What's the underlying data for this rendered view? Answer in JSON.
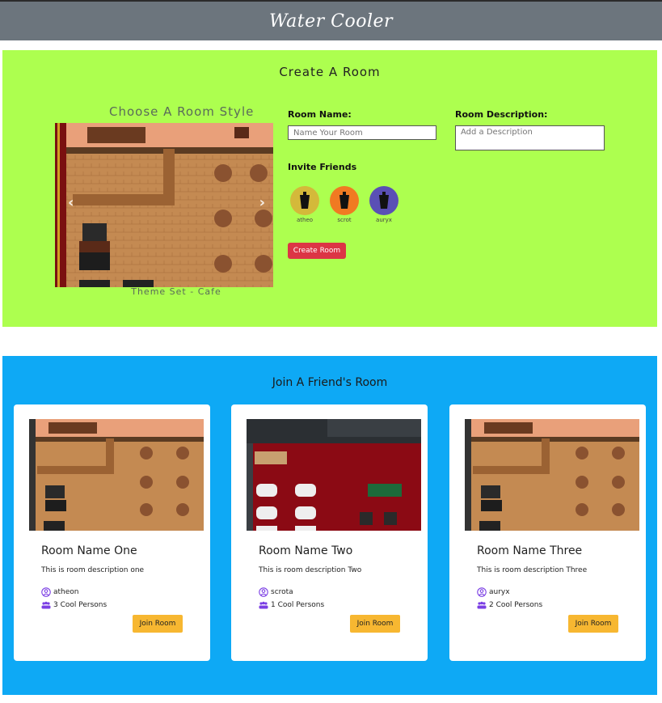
{
  "header": {
    "title": "Water Cooler"
  },
  "create_room": {
    "title": "Create A Room",
    "style_title": "Choose A Room Style",
    "theme_caption": "Theme Set - Cafe",
    "room_name_label": "Room Name:",
    "room_name_placeholder": "Name Your Room",
    "room_desc_label": "Room Description:",
    "room_desc_placeholder": "Add a Description",
    "invite_label": "Invite Friends",
    "friends": [
      {
        "name": "atheo",
        "color": "#d4b93a"
      },
      {
        "name": "scrot",
        "color": "#f07a22"
      },
      {
        "name": "auryx",
        "color": "#5a4fb5"
      }
    ],
    "button_label": "Create Room",
    "carousel_prev_icon": "chevron-left-icon",
    "carousel_next_icon": "chevron-right-icon"
  },
  "join_room": {
    "title": "Join A Friend's Room",
    "rooms": [
      {
        "name": "Room Name One",
        "description": "This is room description one",
        "owner": "atheon",
        "count": "3 Cool Persons",
        "button": "Join Room",
        "theme": "cafe"
      },
      {
        "name": "Room Name Two",
        "description": "This is room description Two",
        "owner": "scrota",
        "count": "1 Cool Persons",
        "button": "Join Room",
        "theme": "casino"
      },
      {
        "name": "Room Name Three",
        "description": "This is room description Three",
        "owner": "auryx",
        "count": "2 Cool Persons",
        "button": "Join Room",
        "theme": "cafe"
      }
    ]
  },
  "colors": {
    "header_bg": "#6c757d",
    "create_bg": "#adff4f",
    "join_bg": "#0ea9f5",
    "create_button": "#dc3545",
    "join_button": "#f7b731",
    "icon_accent": "#7b3fe4"
  }
}
